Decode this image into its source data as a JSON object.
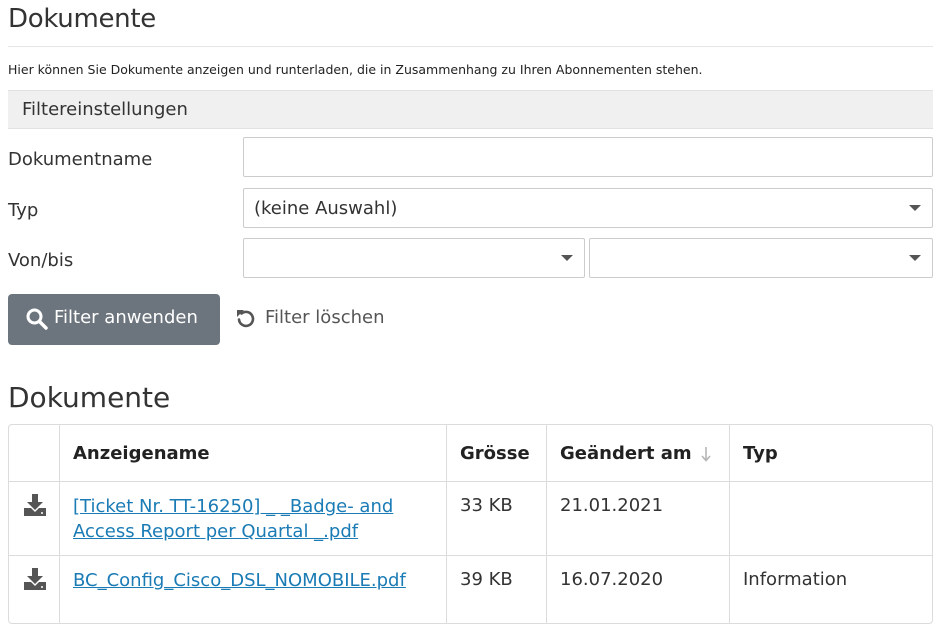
{
  "page": {
    "title": "Dokumente",
    "intro": "Hier können Sie Dokumente anzeigen und runterladen, die in Zusammenhang zu Ihren Abonnementen stehen."
  },
  "filter": {
    "header": "Filtereinstellungen",
    "name_label": "Dokumentname",
    "name_value": "",
    "type_label": "Typ",
    "type_value": "(keine Auswahl)",
    "range_label": "Von/bis",
    "from_value": "",
    "to_value": "",
    "apply_label": "Filter anwenden",
    "clear_label": "Filter löschen"
  },
  "documents": {
    "title": "Dokumente",
    "columns": {
      "name": "Anzeigename",
      "size": "Grösse",
      "changed": "Geändert am",
      "type": "Typ"
    },
    "rows": [
      {
        "name_line1": "[Ticket Nr. TT-16250] _ _Badge- and",
        "name_line2": "Access Report per Quartal _.pdf",
        "size": "33 KB",
        "changed": "21.01.2021",
        "type": ""
      },
      {
        "name_line1": "BC_Config_Cisco_DSL_NOMOBILE.pdf",
        "size": "39 KB",
        "changed": "16.07.2020",
        "type": "Information"
      }
    ]
  },
  "colors": {
    "link": "#1a7bb5",
    "button_bg": "#6c757d",
    "header_bg": "#f0f0f0"
  }
}
